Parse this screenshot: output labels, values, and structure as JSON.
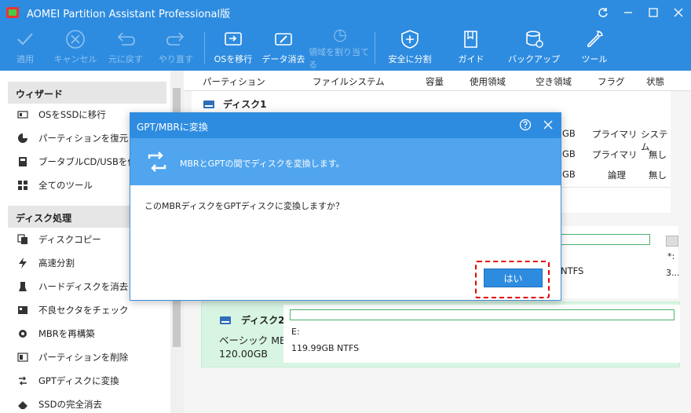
{
  "window": {
    "title": "AOMEI Partition Assistant Professional版"
  },
  "toolbar": [
    {
      "label": "適用",
      "icon": "check-icon",
      "enabled": false
    },
    {
      "label": "キャンセル",
      "icon": "cancel-icon",
      "enabled": false
    },
    {
      "label": "元に戻す",
      "icon": "undo-icon",
      "enabled": false
    },
    {
      "label": "やり直す",
      "icon": "redo-icon",
      "enabled": false
    },
    {
      "label": "OSを移行",
      "icon": "migrate-os-icon",
      "enabled": true
    },
    {
      "label": "データ消去",
      "icon": "wipe-data-icon",
      "enabled": true
    },
    {
      "label": "領域を割り当てる",
      "icon": "allocate-space-icon",
      "enabled": false
    },
    {
      "label": "安全に分割",
      "icon": "safe-split-icon",
      "enabled": true
    },
    {
      "label": "ガイド",
      "icon": "guide-icon",
      "enabled": true
    },
    {
      "label": "バックアップ",
      "icon": "backup-icon",
      "enabled": true
    },
    {
      "label": "ツール",
      "icon": "tools-icon",
      "enabled": true
    }
  ],
  "sidebar": {
    "wizard_title": "ウィザード",
    "wizard_items": [
      {
        "label": "OSをSSDに移行",
        "icon": "ssd-migrate-icon"
      },
      {
        "label": "パーティションを復元",
        "icon": "partition-recovery-icon"
      },
      {
        "label": "ブータブルCD/USBを作成",
        "icon": "bootable-media-icon"
      },
      {
        "label": "全てのツール",
        "icon": "all-tools-icon"
      }
    ],
    "disk_title": "ディスク処理",
    "disk_items": [
      {
        "label": "ディスクコピー",
        "icon": "disk-copy-icon"
      },
      {
        "label": "高速分割",
        "icon": "quick-partition-icon"
      },
      {
        "label": "ハードディスクを消去",
        "icon": "wipe-disk-icon"
      },
      {
        "label": "不良セクタをチェック",
        "icon": "bad-sector-icon"
      },
      {
        "label": "MBRを再構築",
        "icon": "rebuild-mbr-icon"
      },
      {
        "label": "パーティションを削除",
        "icon": "delete-partition-icon"
      },
      {
        "label": "GPTディスクに変換",
        "icon": "convert-gpt-icon"
      },
      {
        "label": "SSDの完全消去",
        "icon": "ssd-erase-icon"
      }
    ]
  },
  "table": {
    "columns": [
      "パーティション",
      "ファイルシステム",
      "容量",
      "使用領域",
      "空き領域",
      "フラグ",
      "状態"
    ],
    "disk1_label": "ディスク1",
    "rows": [
      {
        "free": "GB",
        "flag": "プライマリ",
        "status": "システム"
      },
      {
        "free": "GB",
        "flag": "プライマリ",
        "status": "無し"
      },
      {
        "free": "GB",
        "flag": "論理",
        "status": "無し"
      }
    ]
  },
  "map": {
    "panel_label_ntfs": "NTFS",
    "small_drive_label": "*:",
    "small_drive_info": "3...",
    "disk2": {
      "name": "ディスク2",
      "type": "ベーシック MBR",
      "size": "120.00GB",
      "partition_label": "E:",
      "partition_info": "119.99GB NTFS"
    }
  },
  "dialog": {
    "title": "GPT/MBRに変換",
    "banner": "MBRとGPTの間でディスクを変換します。",
    "question": "このMBRディスクをGPTディスクに変換しますか？",
    "yes": "はい"
  }
}
